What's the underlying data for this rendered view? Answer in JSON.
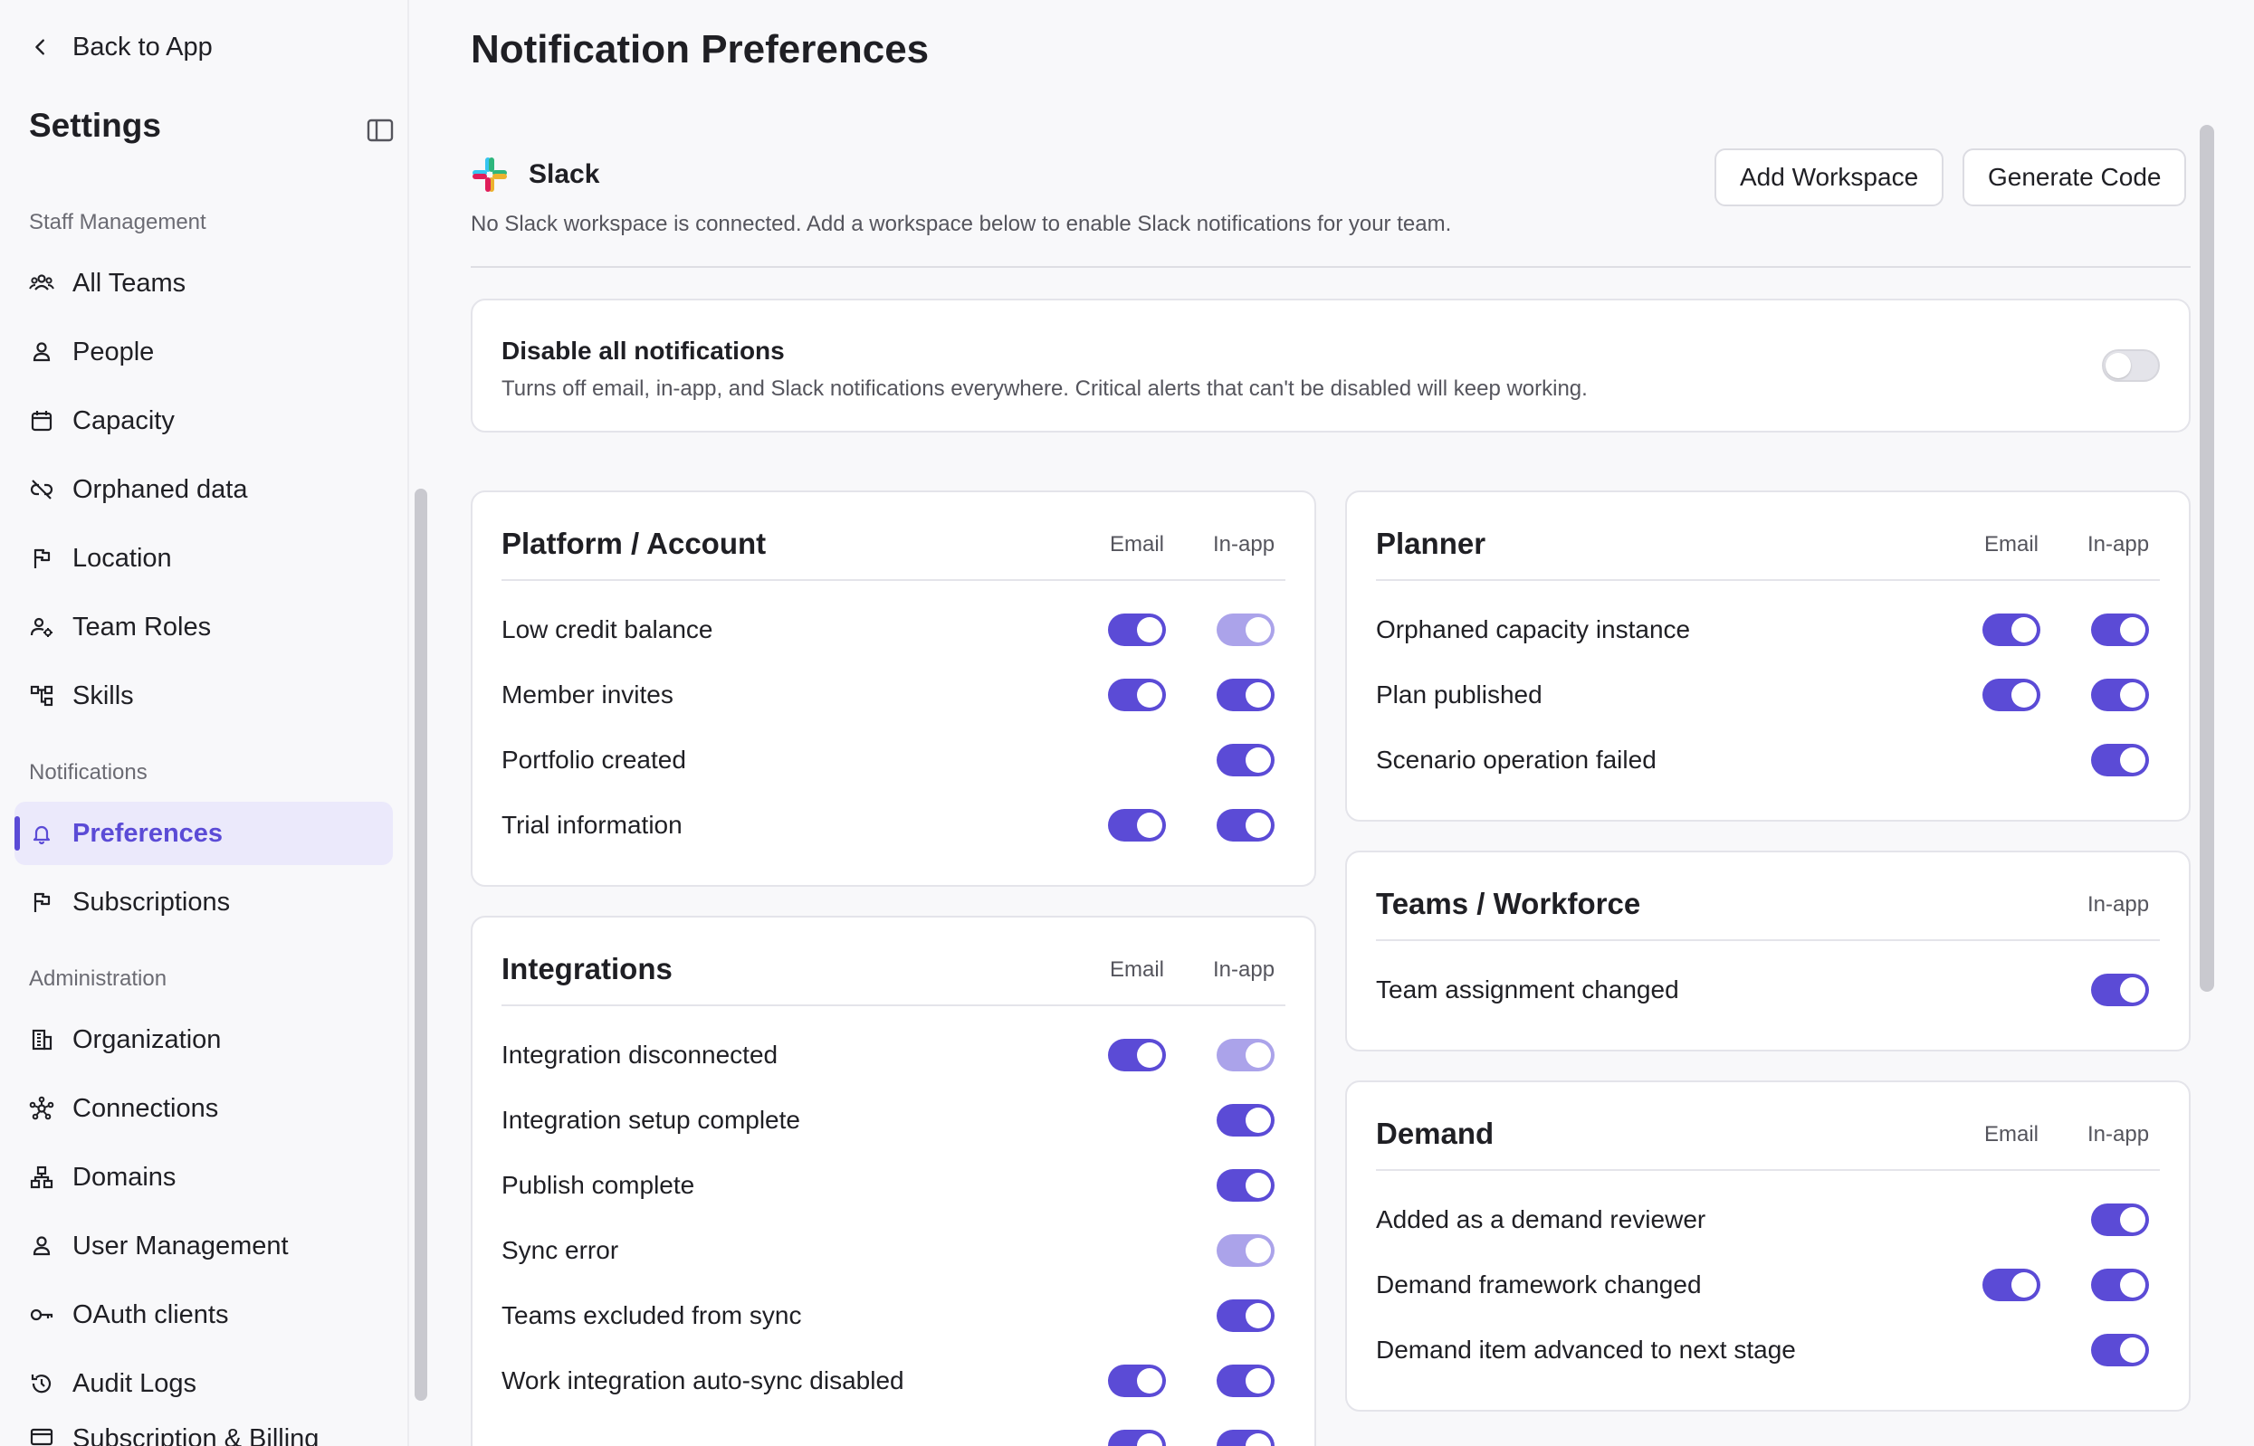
{
  "sidebar": {
    "back_label": "Back to App",
    "title": "Settings",
    "sections": {
      "staff": "Staff Management",
      "notifications": "Notifications",
      "administration": "Administration"
    },
    "staff_items": [
      {
        "label": "All Teams",
        "icon": "teams-icon"
      },
      {
        "label": "People",
        "icon": "person-icon"
      },
      {
        "label": "Capacity",
        "icon": "calendar-icon"
      },
      {
        "label": "Orphaned data",
        "icon": "unlink-icon"
      },
      {
        "label": "Location",
        "icon": "flag-icon"
      },
      {
        "label": "Team Roles",
        "icon": "user-gear-icon"
      },
      {
        "label": "Skills",
        "icon": "hierarchy-icon"
      }
    ],
    "notification_items": [
      {
        "label": "Preferences",
        "icon": "bell-icon",
        "active": true
      },
      {
        "label": "Subscriptions",
        "icon": "flag-icon"
      }
    ],
    "admin_items": [
      {
        "label": "Organization",
        "icon": "building-icon"
      },
      {
        "label": "Connections",
        "icon": "network-icon"
      },
      {
        "label": "Domains",
        "icon": "sitemap-icon"
      },
      {
        "label": "User Management",
        "icon": "person-icon"
      },
      {
        "label": "OAuth clients",
        "icon": "key-icon"
      },
      {
        "label": "Audit Logs",
        "icon": "history-icon"
      },
      {
        "label": "Subscription & Billing",
        "icon": "card-icon"
      }
    ]
  },
  "main": {
    "title": "Notification Preferences",
    "slack": {
      "name": "Slack",
      "description": "No Slack workspace is connected. Add a workspace below to enable Slack notifications for your team.",
      "add_workspace_label": "Add Workspace",
      "generate_code_label": "Generate Code"
    },
    "disable_all": {
      "title": "Disable all notifications",
      "description": "Turns off email, in-app, and Slack notifications everywhere. Critical alerts that can't be disabled will keep working.",
      "enabled": false
    },
    "column_labels": {
      "email": "Email",
      "inapp": "In-app"
    },
    "groups": {
      "platform": {
        "title": "Platform / Account",
        "rows": [
          {
            "label": "Low credit balance",
            "email": "on",
            "inapp": "locked"
          },
          {
            "label": "Member invites",
            "email": "on",
            "inapp": "on"
          },
          {
            "label": "Portfolio created",
            "email": null,
            "inapp": "on"
          },
          {
            "label": "Trial information",
            "email": "on",
            "inapp": "on"
          }
        ]
      },
      "integrations": {
        "title": "Integrations",
        "rows": [
          {
            "label": "Integration disconnected",
            "email": "on",
            "inapp": "locked"
          },
          {
            "label": "Integration setup complete",
            "email": null,
            "inapp": "on"
          },
          {
            "label": "Publish complete",
            "email": null,
            "inapp": "on"
          },
          {
            "label": "Sync error",
            "email": null,
            "inapp": "locked"
          },
          {
            "label": "Teams excluded from sync",
            "email": null,
            "inapp": "on"
          },
          {
            "label": "Work integration auto-sync disabled",
            "email": "on",
            "inapp": "on"
          }
        ]
      },
      "planner": {
        "title": "Planner",
        "rows": [
          {
            "label": "Orphaned capacity instance",
            "email": "on",
            "inapp": "on"
          },
          {
            "label": "Plan published",
            "email": "on",
            "inapp": "on"
          },
          {
            "label": "Scenario operation failed",
            "email": null,
            "inapp": "on"
          }
        ]
      },
      "teams": {
        "title": "Teams / Workforce",
        "rows": [
          {
            "label": "Team assignment changed",
            "email": null,
            "inapp": "on"
          }
        ]
      },
      "demand": {
        "title": "Demand",
        "rows": [
          {
            "label": "Added as a demand reviewer",
            "email": null,
            "inapp": "on"
          },
          {
            "label": "Demand framework changed",
            "email": "on",
            "inapp": "on"
          },
          {
            "label": "Demand item advanced to next stage",
            "email": null,
            "inapp": "on"
          }
        ]
      }
    }
  },
  "colors": {
    "accent": "#5b4bd6",
    "accent_dim": "#aba3ea",
    "active_bg": "#ebe9fb"
  }
}
